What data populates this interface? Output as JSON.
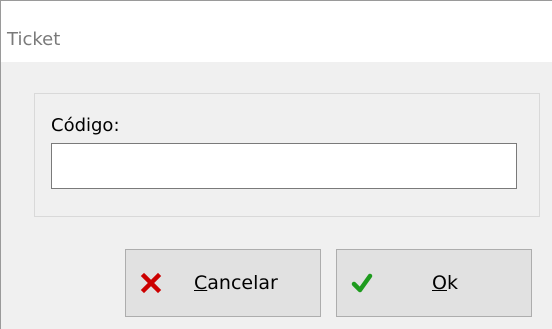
{
  "window": {
    "title": "Ticket"
  },
  "form": {
    "code_label": "Código:",
    "code_value": "",
    "code_placeholder": ""
  },
  "buttons": {
    "cancel": {
      "mnemonic": "C",
      "rest": "ancelar",
      "icon": "close-icon",
      "icon_color": "#cc0000"
    },
    "ok": {
      "mnemonic": "O",
      "rest": "k",
      "icon": "check-icon",
      "icon_color": "#1e9b1e"
    }
  }
}
